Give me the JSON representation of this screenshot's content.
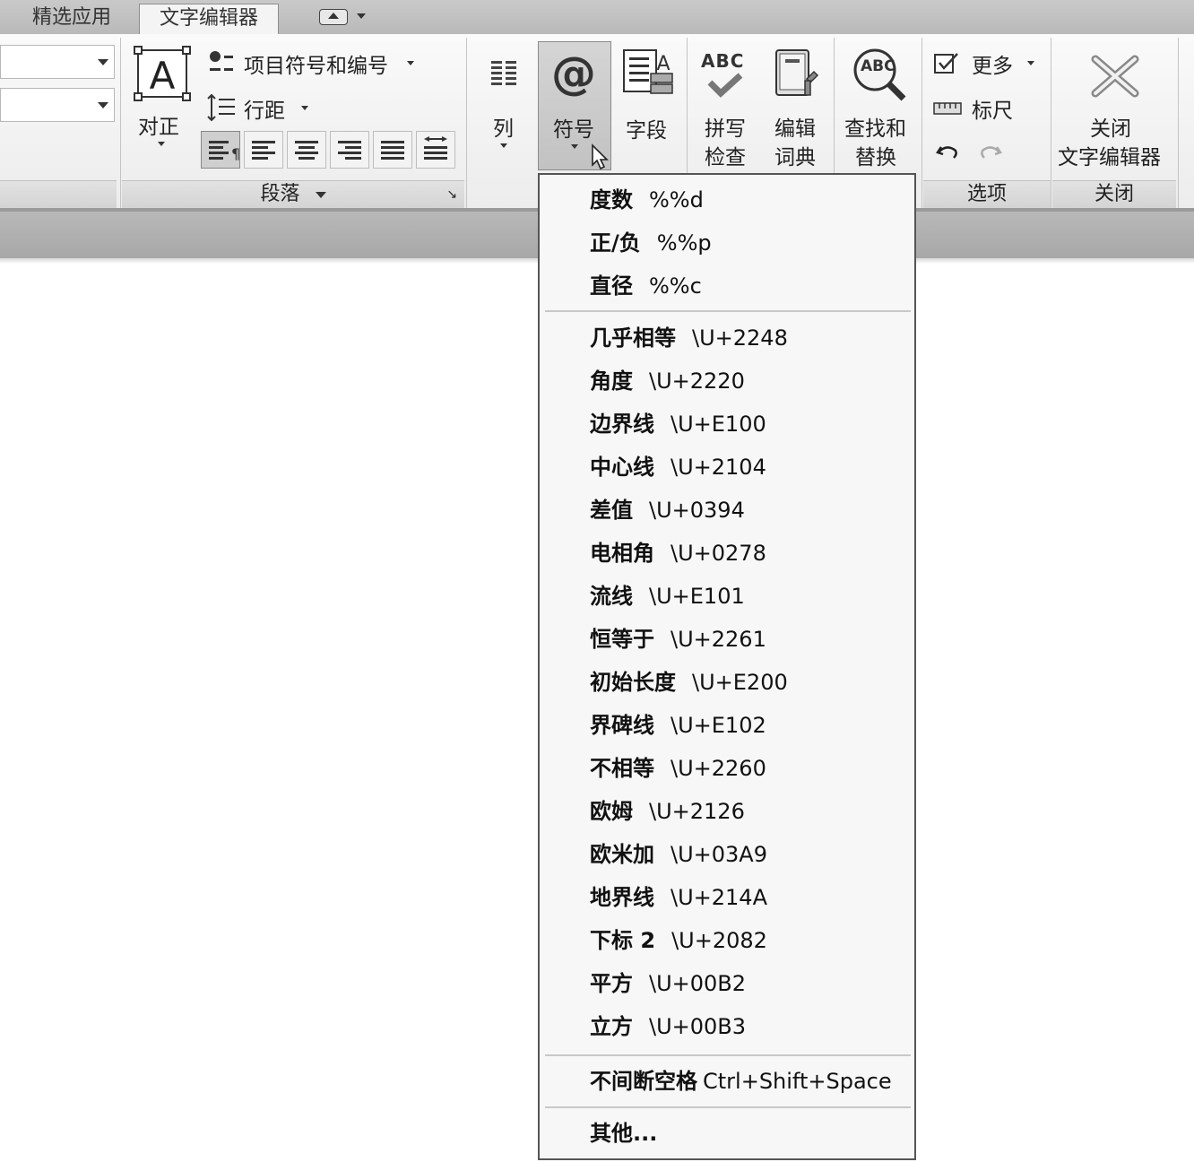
{
  "tabs": [
    {
      "label": "精选应用",
      "active": false
    },
    {
      "label": "文字编辑器",
      "active": true
    }
  ],
  "ribbon": {
    "paragraph": {
      "justify_label": "对正",
      "bullets_label": "项目符号和编号",
      "line_spacing_label": "行距",
      "panel_title": "段落"
    },
    "insert": {
      "columns_label": "列",
      "symbol_label": "符号",
      "field_label": "字段"
    },
    "spell": {
      "spell_check_line1": "拼写",
      "spell_check_line2": "检查",
      "edit_dict_line1": "编辑",
      "edit_dict_line2": "词典",
      "abc_text": "ABC"
    },
    "tools": {
      "find_replace_line1": "查找和",
      "find_replace_line2": "替换",
      "abc_text": "ABC"
    },
    "options": {
      "more_label": "更多",
      "ruler_label": "标尺",
      "panel_title": "选项"
    },
    "close": {
      "close_line1": "关闭",
      "close_line2": "文字编辑器",
      "panel_title": "关闭"
    }
  },
  "symbol_menu": {
    "group1": [
      {
        "name": "度数",
        "code": "%%d"
      },
      {
        "name": "正/负",
        "code": "%%p"
      },
      {
        "name": "直径",
        "code": "%%c"
      }
    ],
    "group2": [
      {
        "name": "几乎相等",
        "code": "\\U+2248"
      },
      {
        "name": "角度",
        "code": "\\U+2220"
      },
      {
        "name": "边界线",
        "code": "\\U+E100"
      },
      {
        "name": "中心线",
        "code": "\\U+2104"
      },
      {
        "name": "差值",
        "code": "\\U+0394"
      },
      {
        "name": "电相角",
        "code": "\\U+0278"
      },
      {
        "name": "流线",
        "code": "\\U+E101"
      },
      {
        "name": "恒等于",
        "code": "\\U+2261"
      },
      {
        "name": "初始长度",
        "code": "\\U+E200"
      },
      {
        "name": "界碑线",
        "code": "\\U+E102"
      },
      {
        "name": "不相等",
        "code": "\\U+2260"
      },
      {
        "name": "欧姆",
        "code": "\\U+2126"
      },
      {
        "name": "欧米加",
        "code": "\\U+03A9"
      },
      {
        "name": "地界线",
        "code": "\\U+214A"
      },
      {
        "name": "下标 2",
        "code": "\\U+2082"
      },
      {
        "name": "平方",
        "code": "\\U+00B2"
      },
      {
        "name": "立方",
        "code": "\\U+00B3"
      }
    ],
    "nbsp": {
      "name": "不间断空格",
      "code": "Ctrl+Shift+Space"
    },
    "other": {
      "name": "其他..."
    }
  }
}
